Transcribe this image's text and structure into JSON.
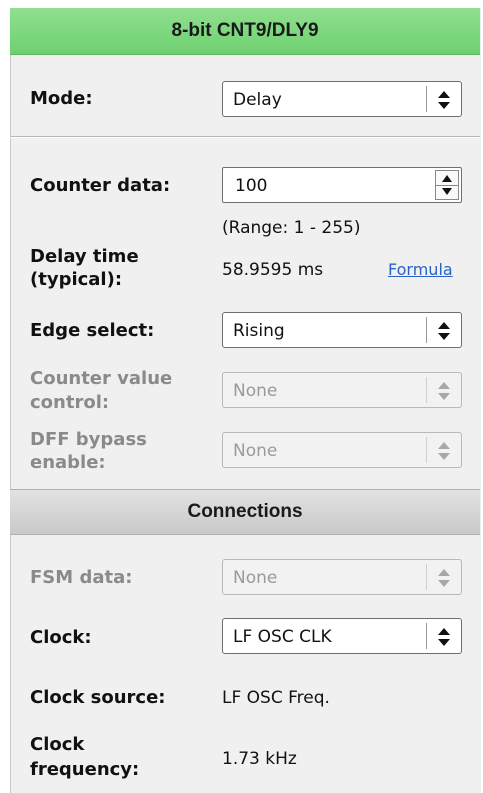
{
  "header": {
    "title": "8-bit CNT9/DLY9"
  },
  "mode": {
    "label": "Mode:",
    "value": "Delay"
  },
  "counter_data": {
    "label": "Counter data:",
    "value": "100",
    "range": "(Range:  1 - 255)"
  },
  "delay_time": {
    "label_line1": "Delay time",
    "label_line2": "(typical):",
    "value": "58.9595 ms",
    "formula_link": "Formula"
  },
  "edge_select": {
    "label": "Edge select:",
    "value": "Rising"
  },
  "counter_value_control": {
    "label_line1": "Counter value",
    "label_line2": "control:",
    "value": "None"
  },
  "dff_bypass": {
    "label_line1": "DFF bypass",
    "label_line2": "enable:",
    "value": "None"
  },
  "connections": {
    "title": "Connections"
  },
  "fsm_data": {
    "label": "FSM data:",
    "value": "None"
  },
  "clock": {
    "label": "Clock:",
    "value": "LF OSC CLK"
  },
  "clock_source": {
    "label": "Clock source:",
    "value": "LF OSC Freq."
  },
  "clock_frequency": {
    "label_line1": "Clock",
    "label_line2": "frequency:",
    "value": "1.73 kHz"
  },
  "icons": {
    "dropdown": "up-down-arrows-icon",
    "spinner": "spinner-arrows-icon"
  },
  "colors": {
    "header_green": "#7dd87d",
    "link_blue": "#2a64c8",
    "disabled_text": "#8a8a8a"
  }
}
